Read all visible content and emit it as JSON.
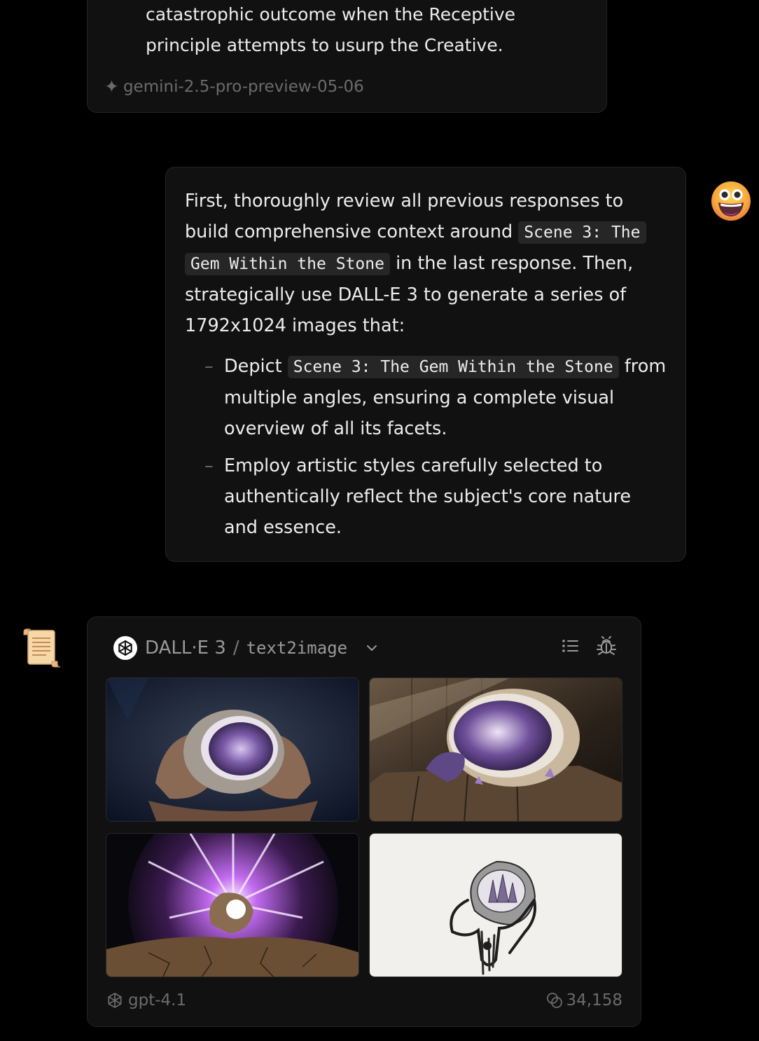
{
  "previous_message": {
    "lines": [
      "catastrophic outcome when the Receptive",
      "principle attempts to usurp the Creative."
    ],
    "model": "gemini-2.5-pro-preview-05-06"
  },
  "user_message": {
    "intro_before_code": "First, thoroughly review all previous responses to build comprehensive context around",
    "scene_code": "Scene 3: The Gem Within the Stone",
    "intro_after_code": "in the last response. Then, strategically use DALL-E 3 to generate a series of 1792x1024 images that:",
    "bullet_1_before": "Depict",
    "bullet_1_after": "from multiple angles, ensuring a complete visual overview of all its facets.",
    "bullet_2": "Employ artistic styles carefully selected to authentically reflect the subject's core nature and essence.",
    "dash": "–"
  },
  "tool_call": {
    "tool_name": "DALL·E 3",
    "separator": "/",
    "mode": "text2image",
    "icons": [
      "openai-icon",
      "chevron-down-icon",
      "list-icon",
      "bug-icon"
    ],
    "images": [
      {
        "subject": "hands holding amethyst geode"
      },
      {
        "subject": "split geode on wooden table"
      },
      {
        "subject": "exploding geode with light rays"
      },
      {
        "subject": "ink sketch of hand holding geode"
      }
    ],
    "model": "gpt-4.1",
    "tokens": "34,158"
  },
  "colors": {
    "background": "#000000",
    "card": "#111111",
    "border": "#242424",
    "text": "#ededed",
    "muted": "#6b6b6b",
    "code_bg": "#262626"
  }
}
